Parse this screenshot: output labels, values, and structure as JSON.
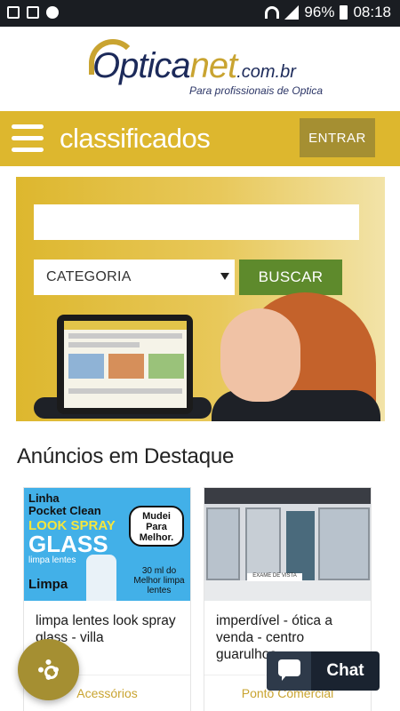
{
  "status_bar": {
    "battery_percent": "96%",
    "time": "08:18",
    "icons": [
      "gallery-icon",
      "flipboard-icon",
      "settings-dot-icon",
      "wifi-icon",
      "signal-icon",
      "battery-icon"
    ]
  },
  "brand": {
    "logo_main": "Optica",
    "logo_accent": "net",
    "logo_domain": ".com.br",
    "tagline": "Para profissionais de Optica",
    "accent_color": "#c9a431",
    "primary_color": "#1c2a5a"
  },
  "nav": {
    "title": "classificados",
    "login_label": "ENTRAR",
    "bar_color": "#ddb72e"
  },
  "search": {
    "input_value": "",
    "category_selected": "CATEGORIA",
    "submit_label": "BUSCAR",
    "submit_color": "#5e8a2c"
  },
  "featured": {
    "heading": "Anúncios em Destaque",
    "cards": [
      {
        "title": "limpa lentes look spray glass - villa",
        "category": "Acessórios",
        "image_text": {
          "line1": "Linha",
          "line2": "Pocket Clean",
          "line3": "LOOK SPRAY",
          "line4": "GLASS",
          "line5": "limpa lentes",
          "line6": "Limpa",
          "bubble": "Mudei Para Melhor.",
          "ml_text": "30 ml do Melhor limpa lentes"
        }
      },
      {
        "title": "imperdível - ótica a venda - centro guarulhos",
        "category": "Ponto Comercial",
        "image_text": {
          "sign": "EXAME DE VISTA"
        }
      }
    ]
  },
  "floating": {
    "settings_icon": "gear-icon",
    "chat_label": "Chat"
  }
}
